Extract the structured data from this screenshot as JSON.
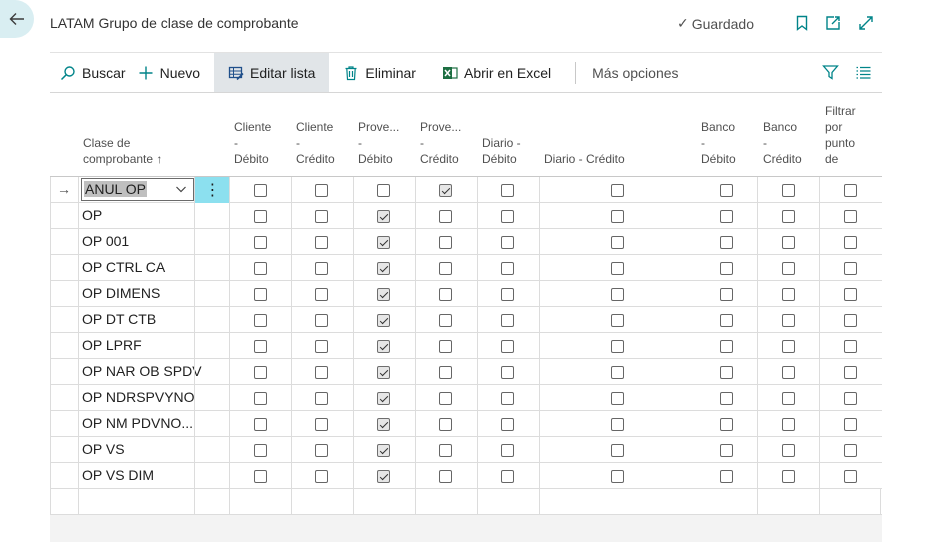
{
  "header": {
    "title": "LATAM Grupo de clase de comprobante",
    "saved_label": "Guardado",
    "icons": [
      "back-arrow-icon",
      "bookmark-icon",
      "open-in-new-window-icon",
      "expand-icon"
    ]
  },
  "toolbar": {
    "search_label": "Buscar",
    "new_label": "Nuevo",
    "edit_list_label": "Editar lista",
    "delete_label": "Eliminar",
    "excel_label": "Abrir en Excel",
    "more_label": "Más opciones",
    "right_icons": [
      "filter-icon",
      "list-view-icon"
    ]
  },
  "columns": [
    {
      "key": "code",
      "lines": [
        "Clase de",
        "comprobante ↑"
      ]
    },
    {
      "key": "cliente_debito",
      "lines": [
        "Cliente",
        "-",
        "Débito"
      ]
    },
    {
      "key": "cliente_credito",
      "lines": [
        "Cliente",
        "-",
        "Crédito"
      ]
    },
    {
      "key": "prov_debito",
      "lines": [
        "Prove...",
        "-",
        "Débito"
      ]
    },
    {
      "key": "prov_credito",
      "lines": [
        "Prove...",
        "-",
        "Crédito"
      ]
    },
    {
      "key": "diario_debito",
      "lines": [
        "Diario -",
        "Débito"
      ]
    },
    {
      "key": "diario_credito",
      "lines": [
        "Diario - Crédito"
      ]
    },
    {
      "key": "banco_debito",
      "lines": [
        "Banco",
        "-",
        "Débito"
      ]
    },
    {
      "key": "banco_credito",
      "lines": [
        "Banco",
        "-",
        "Crédito"
      ]
    },
    {
      "key": "filtrar",
      "lines": [
        "Filtrar",
        "por",
        "punto",
        "de"
      ]
    }
  ],
  "rows": [
    {
      "code": "ANUL OP",
      "selected": true,
      "values": [
        false,
        false,
        false,
        true,
        false,
        false,
        false,
        false,
        false
      ]
    },
    {
      "code": "OP",
      "values": [
        false,
        false,
        true,
        false,
        false,
        false,
        false,
        false,
        false
      ]
    },
    {
      "code": "OP 001",
      "values": [
        false,
        false,
        true,
        false,
        false,
        false,
        false,
        false,
        false
      ]
    },
    {
      "code": "OP CTRL CA",
      "values": [
        false,
        false,
        true,
        false,
        false,
        false,
        false,
        false,
        false
      ]
    },
    {
      "code": "OP DIMENS",
      "values": [
        false,
        false,
        true,
        false,
        false,
        false,
        false,
        false,
        false
      ]
    },
    {
      "code": "OP DT CTB",
      "values": [
        false,
        false,
        true,
        false,
        false,
        false,
        false,
        false,
        false
      ]
    },
    {
      "code": "OP LPRF",
      "values": [
        false,
        false,
        true,
        false,
        false,
        false,
        false,
        false,
        false
      ]
    },
    {
      "code": "OP NAR OB SPDV",
      "values": [
        false,
        false,
        true,
        false,
        false,
        false,
        false,
        false,
        false
      ]
    },
    {
      "code": "OP NDRSPVYNO",
      "values": [
        false,
        false,
        true,
        false,
        false,
        false,
        false,
        false,
        false
      ]
    },
    {
      "code": "OP NM PDVNO...",
      "values": [
        false,
        false,
        true,
        false,
        false,
        false,
        false,
        false,
        false
      ]
    },
    {
      "code": "OP VS",
      "values": [
        false,
        false,
        true,
        false,
        false,
        false,
        false,
        false,
        false
      ]
    },
    {
      "code": "OP VS DIM",
      "values": [
        false,
        false,
        true,
        false,
        false,
        false,
        false,
        false,
        false
      ]
    }
  ],
  "colors": {
    "accent": "#008489",
    "selected_row_marker": "#8ce0ef",
    "active_button": "#e1e5e8"
  }
}
